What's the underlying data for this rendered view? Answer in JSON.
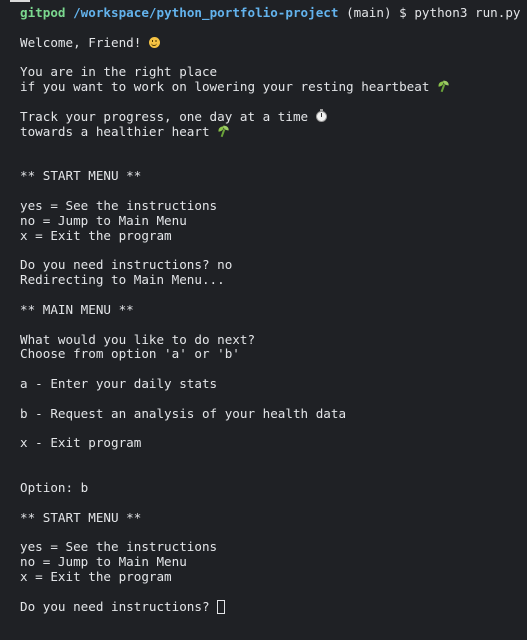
{
  "prompt": {
    "user": "gitpod",
    "path": "/workspace/python_portfolio-project",
    "branch": "(main)",
    "symbol": "$",
    "command": "python3 run.py"
  },
  "output": {
    "welcome": "Welcome, Friend!",
    "intro_line1": "You are in the right place",
    "intro_line2": "if you want to work on lowering your resting heartbeat",
    "track_line1": "Track your progress, one day at a time",
    "track_line2": "towards a healthier heart",
    "start_menu_title": "** START MENU **",
    "start_yes": "yes = See the instructions",
    "start_no": "no = Jump to Main Menu",
    "start_x": "x = Exit the program",
    "question_1": "Do you need instructions? no",
    "redirecting": "Redirecting to Main Menu...",
    "main_menu_title": "** MAIN MENU **",
    "main_q1": "What would you like to do next?",
    "main_q2": "Choose from option 'a' or 'b'",
    "option_a": "a - Enter your daily stats",
    "option_b": "b - Request an analysis of your health data",
    "option_x": "x - Exit program",
    "option_choice": "Option: b",
    "start_menu_title_2": "** START MENU **",
    "start_yes_2": "yes = See the instructions",
    "start_no_2": "no = Jump to Main Menu",
    "start_x_2": "x = Exit the program",
    "question_2": "Do you need instructions?"
  },
  "icons": {
    "welcome": "smiling-face-icon",
    "heartbeat": "seedling-icon",
    "progress": "stopwatch-icon",
    "healthier": "seedling-icon"
  },
  "colors": {
    "background": "#1f2125",
    "text": "#e3e5e8",
    "prompt_user": "#7bd88f",
    "prompt_path": "#63b3ed"
  }
}
